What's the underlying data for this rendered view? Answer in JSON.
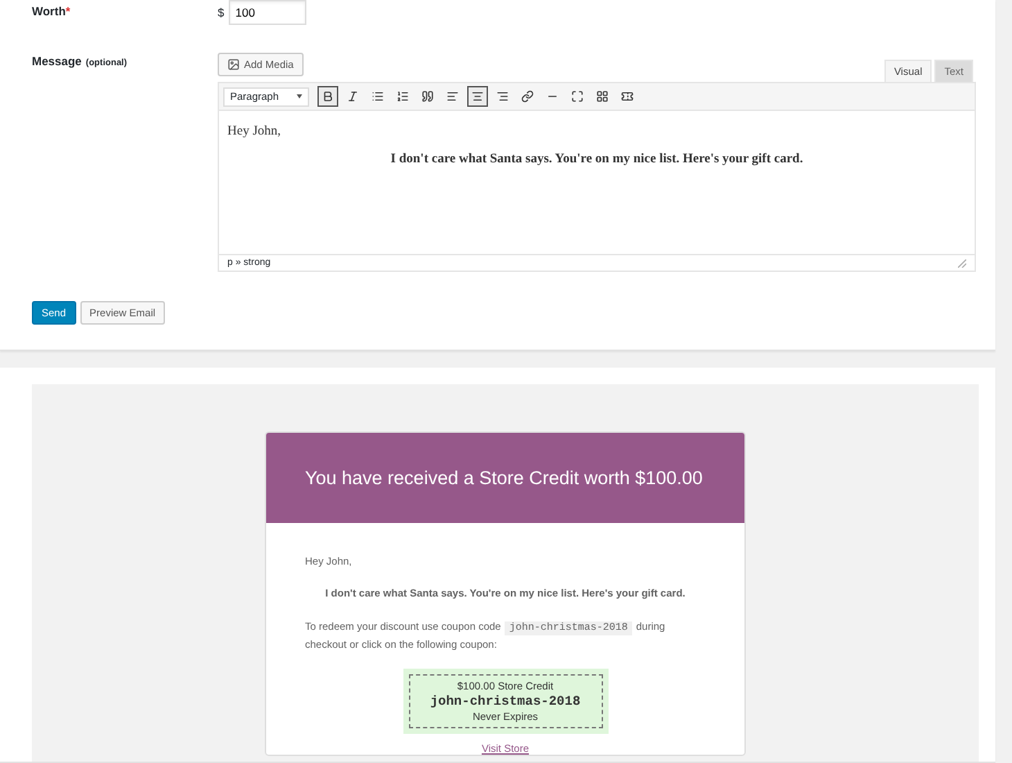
{
  "worth": {
    "label": "Worth",
    "required_mark": "*",
    "currency": "$",
    "value": "100"
  },
  "message": {
    "label": "Message",
    "hint": "(optional)",
    "add_media": "Add Media",
    "editor_tabs": [
      {
        "label": "Visual",
        "selected": true
      },
      {
        "label": "Text",
        "selected": false
      }
    ],
    "format": "Paragraph",
    "toolbar": [
      {
        "kind": "bold",
        "active": true
      },
      {
        "kind": "italic",
        "active": false
      },
      {
        "kind": "bullets",
        "active": false
      },
      {
        "kind": "numbers",
        "active": false
      },
      {
        "kind": "quote",
        "active": false
      },
      {
        "kind": "align-left",
        "active": false
      },
      {
        "kind": "align-center",
        "active": true
      },
      {
        "kind": "align-right",
        "active": false
      },
      {
        "kind": "link",
        "active": false
      },
      {
        "kind": "more",
        "active": false
      },
      {
        "kind": "fullscreen",
        "active": false
      },
      {
        "kind": "toolbar",
        "active": false
      },
      {
        "kind": "ticket",
        "active": false
      }
    ],
    "content": [
      {
        "text": "Hey John,",
        "bold": false,
        "centered": false
      },
      {
        "text": "I don't care what Santa says. You're on my nice list. Here's your gift card.",
        "bold": true,
        "centered": true
      }
    ],
    "path": "p » strong"
  },
  "buttons": [
    {
      "label": "Send",
      "primary": true
    },
    {
      "label": "Preview Email",
      "primary": false
    }
  ],
  "email": {
    "heading": "You have received a Store Credit worth $100.00",
    "greeting": "Hey John,",
    "message": "I don't care what Santa says. You're on my nice list. Here's your gift card.",
    "redeem_before": "To redeem your discount use coupon code",
    "code": "john-christmas-2018",
    "redeem_after": "during checkout or click on the following coupon:",
    "coupon": {
      "title": "$100.00 Store Credit",
      "code": "john-christmas-2018",
      "expiry": "Never Expires"
    },
    "link": "Visit Store"
  }
}
